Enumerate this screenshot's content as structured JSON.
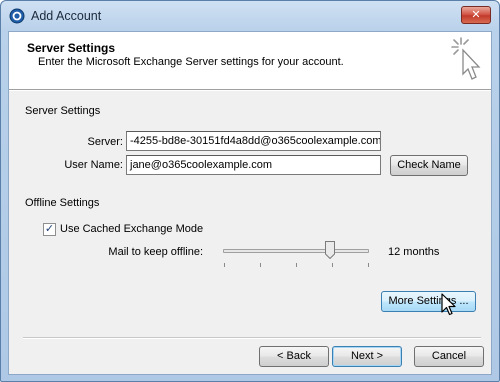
{
  "window": {
    "title": "Add Account",
    "close_label": "✕"
  },
  "header": {
    "title": "Server Settings",
    "subtitle": "Enter the Microsoft Exchange Server settings for your account."
  },
  "server_settings": {
    "section_label": "Server Settings",
    "server_label": "Server:",
    "server_value": "-4255-bd8e-30151fd4a8dd@o365coolexample.com",
    "username_label": "User Name:",
    "username_value": "jane@o365coolexample.com",
    "check_name_label": "Check Name"
  },
  "offline_settings": {
    "section_label": "Offline Settings",
    "cached_mode_label": "Use Cached Exchange Mode",
    "cached_mode_checked": true,
    "mail_offline_label": "Mail to keep offline:",
    "mail_offline_value": "12 months",
    "slider_position_fraction": 0.75
  },
  "buttons": {
    "more_settings": "More Settings ...",
    "back": "< Back",
    "next": "Next >",
    "cancel": "Cancel"
  },
  "colors": {
    "title_bar": "#b9d1ea",
    "close_button": "#c23a2b",
    "dialog_body": "#f0f0f0",
    "button_hover_border": "#3c7fb1"
  },
  "icons": {
    "app": "outlook-icon",
    "header_art": "cursor-sparkle-icon",
    "pointer": "mouse-pointer-icon"
  }
}
